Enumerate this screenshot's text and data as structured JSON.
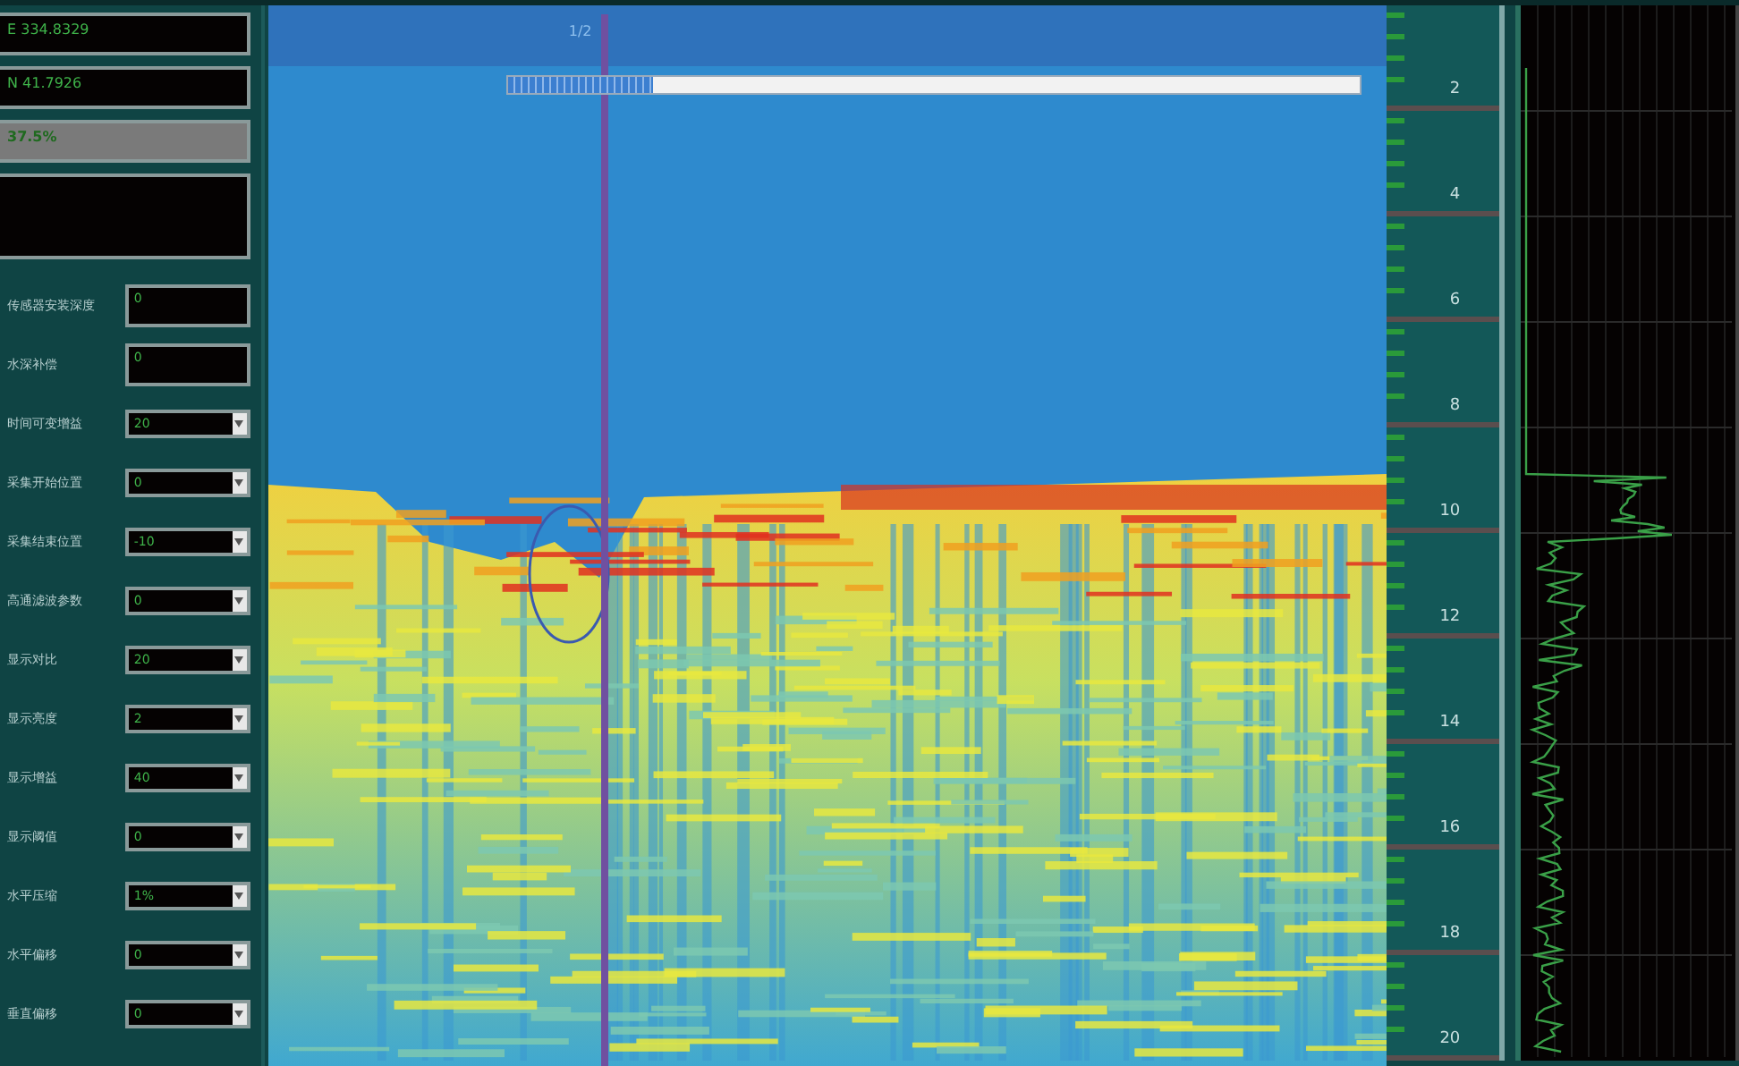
{
  "status_boxes": [
    {
      "kind": "readout",
      "text": "E 334.8329"
    },
    {
      "kind": "readout",
      "text": "N 41.7926"
    },
    {
      "kind": "highlight",
      "text": "37.5%"
    },
    {
      "kind": "blank"
    }
  ],
  "parameters": [
    {
      "label": "传感器安装深度",
      "value": "0",
      "kind": "text"
    },
    {
      "label": "水深补偿",
      "value": "0",
      "kind": "text"
    },
    {
      "label": "时间可变增益",
      "value": "20",
      "kind": "spin"
    },
    {
      "label": "采集开始位置",
      "value": "0",
      "kind": "spin"
    },
    {
      "label": "采集结束位置",
      "value": "-10",
      "kind": "spin"
    },
    {
      "label": "高通滤波参数",
      "value": "0",
      "kind": "spin"
    },
    {
      "label": "显示对比",
      "value": "20",
      "kind": "spin"
    },
    {
      "label": "显示亮度",
      "value": "2",
      "kind": "spin"
    },
    {
      "label": "显示增益",
      "value": "40",
      "kind": "spin"
    },
    {
      "label": "显示阈值",
      "value": "0",
      "kind": "spin"
    },
    {
      "label": "水平压缩",
      "value": "1%",
      "kind": "spin"
    },
    {
      "label": "水平偏移",
      "value": "0",
      "kind": "spin"
    },
    {
      "label": "垂直偏移",
      "value": "0",
      "kind": "spin"
    }
  ],
  "profile": {
    "page": "1/2",
    "progress": {
      "level": 0.17
    }
  },
  "depth_scale": [
    "2",
    "4",
    "6",
    "8",
    "10",
    "12",
    "14",
    "16",
    "18",
    "20"
  ]
}
